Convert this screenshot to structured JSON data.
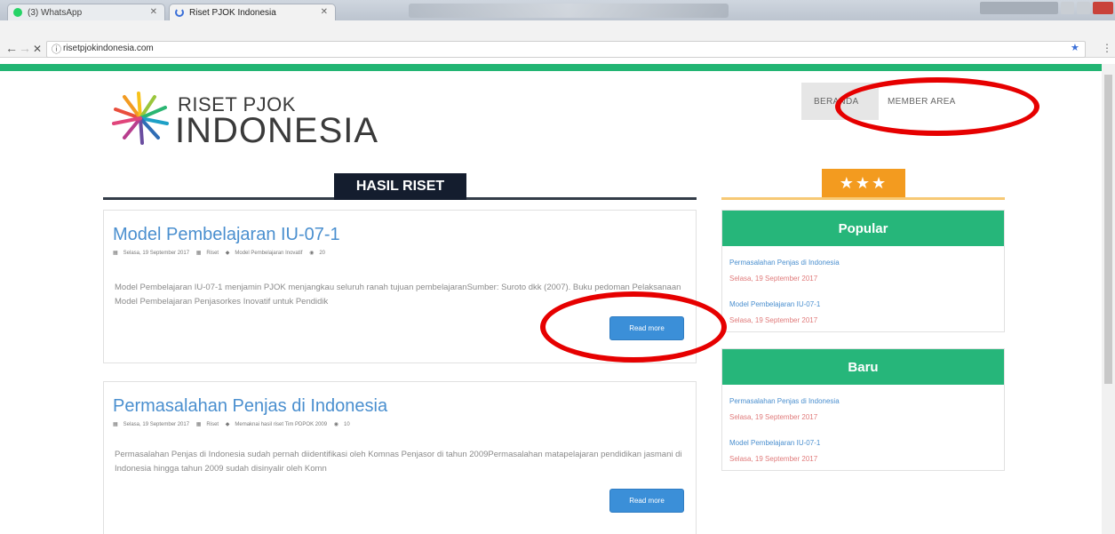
{
  "browser": {
    "tabs": [
      {
        "title": "(3) WhatsApp",
        "active": false
      },
      {
        "title": "Riset PJOK Indonesia",
        "active": true
      }
    ],
    "url": "risetpjokindonesia.com",
    "nav": {
      "back": "←",
      "forward": "→",
      "stop": "✕",
      "info": "ⓘ",
      "bookmark": "★",
      "menu": "⋮"
    }
  },
  "site": {
    "logo_line1": "RISET PJOK",
    "logo_line2": "INDONESIA",
    "nav": [
      "BERANDA",
      "MEMBER AREA"
    ],
    "section_title": "HASIL RISET",
    "colors": {
      "green": "#22b573",
      "navy": "#141d2e",
      "orange": "#f39b1f",
      "link": "#4a8fcf",
      "button": "#3b8fd8"
    }
  },
  "posts": [
    {
      "title": "Model Pembelajaran IU-07-1",
      "meta_date": "Selasa, 19 September 2017",
      "meta_category": "Riset",
      "meta_tag": "Model Pembelajaran Inovatif",
      "meta_views": "20",
      "excerpt": "Model Pembelajaran IU-07-1 menjamin PJOK menjangkau seluruh ranah tujuan pembelajaranSumber: Suroto dkk (2007). Buku pedoman Pelaksanaan Model Pembelajaran Penjasorkes Inovatif untuk Pendidik",
      "button": "Read more"
    },
    {
      "title": "Permasalahan Penjas di Indonesia",
      "meta_date": "Selasa, 19 September 2017",
      "meta_category": "Riset",
      "meta_tag": "Memaknai hasil riset Tim PDPOK 2009",
      "meta_views": "10",
      "excerpt": "Permasalahan Penjas di Indonesia sudah pernah diidentifikasi oleh Komnas Penjasor di tahun 2009Permasalahan matapelajaran pendidikan jasmani di Indonesia hingga tahun 2009 sudah disinyalir oleh Komn",
      "button": "Read more"
    }
  ],
  "sidebar": {
    "stars": "★★★",
    "widgets": [
      {
        "title": "Popular",
        "items": [
          {
            "title": "Permasalahan Penjas di Indonesia",
            "date": "Selasa, 19 September 2017"
          },
          {
            "title": "Model Pembelajaran IU-07-1",
            "date": "Selasa, 19 September 2017"
          }
        ]
      },
      {
        "title": "Baru",
        "items": [
          {
            "title": "Permasalahan Penjas di Indonesia",
            "date": "Selasa, 19 September 2017"
          },
          {
            "title": "Model Pembelajaran IU-07-1",
            "date": "Selasa, 19 September 2017"
          }
        ]
      }
    ]
  }
}
